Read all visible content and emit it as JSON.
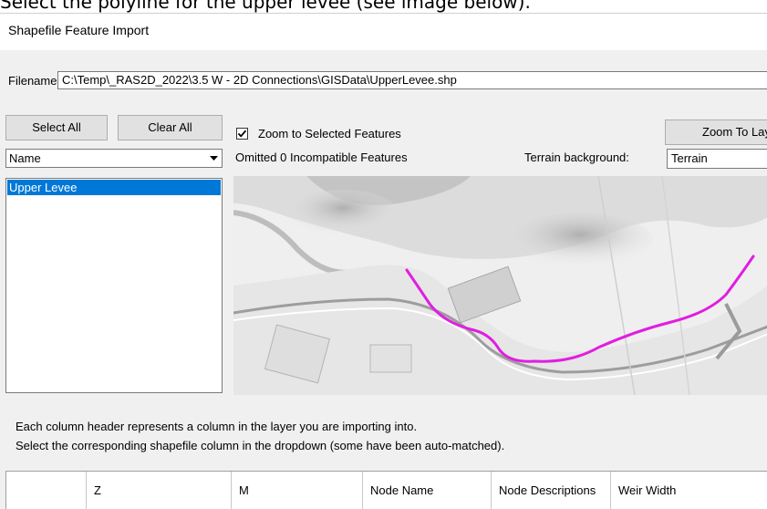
{
  "caption": "Select the polyline for the upper levee (see image below).",
  "window": {
    "title": "Shapefile Feature Import"
  },
  "filename": {
    "label": "Filename:",
    "value": "C:\\Temp\\_RAS2D_2022\\3.5 W - 2D Connections\\GISData\\UpperLevee.shp"
  },
  "buttons": {
    "select_all": "Select All",
    "clear_all": "Clear All",
    "zoom_to_layer": "Zoom To Layer"
  },
  "zoom_selected": {
    "label": "Zoom to Selected Features",
    "checked": true
  },
  "field_select": {
    "value": "Name"
  },
  "omitted": "Omitted 0 Incompatible Features",
  "terrain": {
    "label": "Terrain background:",
    "value": "Terrain"
  },
  "features": [
    {
      "label": "Upper Levee",
      "selected": true
    }
  ],
  "instructions": {
    "line1": "Each column header represents a column in the layer you are importing into.",
    "line2": "Select the corresponding shapefile column in the dropdown (some have been auto-matched)."
  },
  "columns": [
    "",
    "Z",
    "M",
    "Node Name",
    "Node Descriptions",
    "Weir Width"
  ],
  "colors": {
    "selection": "#0078d7",
    "polyline": "#e01ee0"
  }
}
